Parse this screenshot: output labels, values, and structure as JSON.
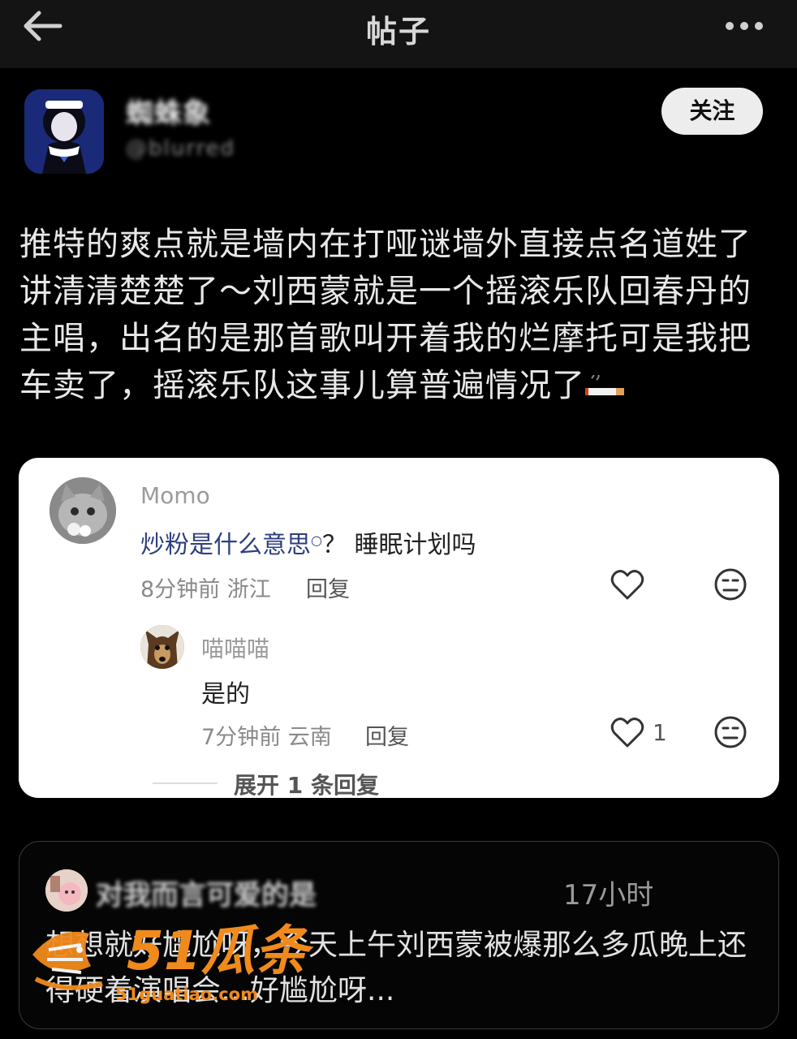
{
  "topbar": {
    "title": "帖子",
    "back_icon": "arrow-left-icon",
    "more_icon": "more-horizontal-icon"
  },
  "author": {
    "name": "蜘蛛象",
    "handle": "@blurred",
    "follow_label": "关注"
  },
  "post": {
    "text": "推特的爽点就是墙内在打哑谜墙外直接点名道姓了讲清清楚楚了～刘西蒙就是一个摇滚乐队回春丹的主唱，出名的是那首歌叫开着我的烂摩托可是我把车卖了，摇滚乐队这事儿算普遍情况了",
    "trailing_emoji": "cigarette-icon"
  },
  "comments": [
    {
      "name": "Momo",
      "text_link": "炒粉是什么意思",
      "text_rest": "？ 睡眠计划吗",
      "meta": "8分钟前 浙江",
      "reply_label": "回复",
      "likes": ""
    },
    {
      "name": "喵喵喵",
      "text_link": "",
      "text_rest": "是的",
      "meta": "7分钟前 云南",
      "reply_label": "回复",
      "likes": "1"
    }
  ],
  "expand_label": "展开 1 条回复",
  "quoted": {
    "name": "对我而言可爱的是",
    "time": "17小时",
    "text": "想想就好尴尬呀，今天上午刘西蒙被爆那么多瓜晚上还得硬着演唱会…好尴尬呀..."
  },
  "watermark": {
    "brand": "51瓜条",
    "url": "51guatiao.com"
  },
  "colors": {
    "background": "#000000",
    "topbar": "#141414",
    "card": "#ffffff",
    "link": "#2f3f7f",
    "watermark": "#f08a1c"
  }
}
